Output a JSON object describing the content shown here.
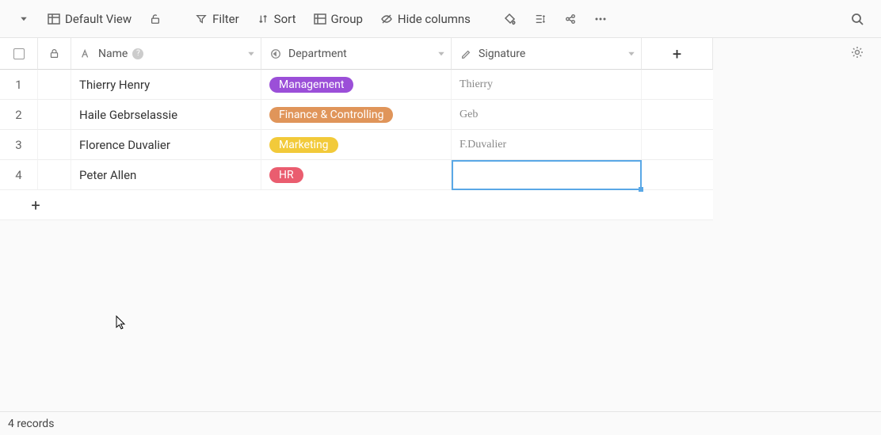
{
  "toolbar": {
    "view_label": "Default View",
    "filter_label": "Filter",
    "sort_label": "Sort",
    "group_label": "Group",
    "hide_label": "Hide columns"
  },
  "columns": {
    "name": "Name",
    "department": "Department",
    "signature": "Signature"
  },
  "rows": [
    {
      "num": "1",
      "name": "Thierry Henry",
      "dept": "Management",
      "dept_color": "#9b4fd8",
      "sig": "Thierry"
    },
    {
      "num": "2",
      "name": "Haile Gebrselassie",
      "dept": "Finance & Controlling",
      "dept_color": "#e0955a",
      "sig": "Geb"
    },
    {
      "num": "3",
      "name": "Florence Duvalier",
      "dept": "Marketing",
      "dept_color": "#f2ca3a",
      "sig": "F.Duvalier"
    },
    {
      "num": "4",
      "name": "Peter Allen",
      "dept": "HR",
      "dept_color": "#ea5d6f",
      "sig": ""
    }
  ],
  "status": "4 records"
}
